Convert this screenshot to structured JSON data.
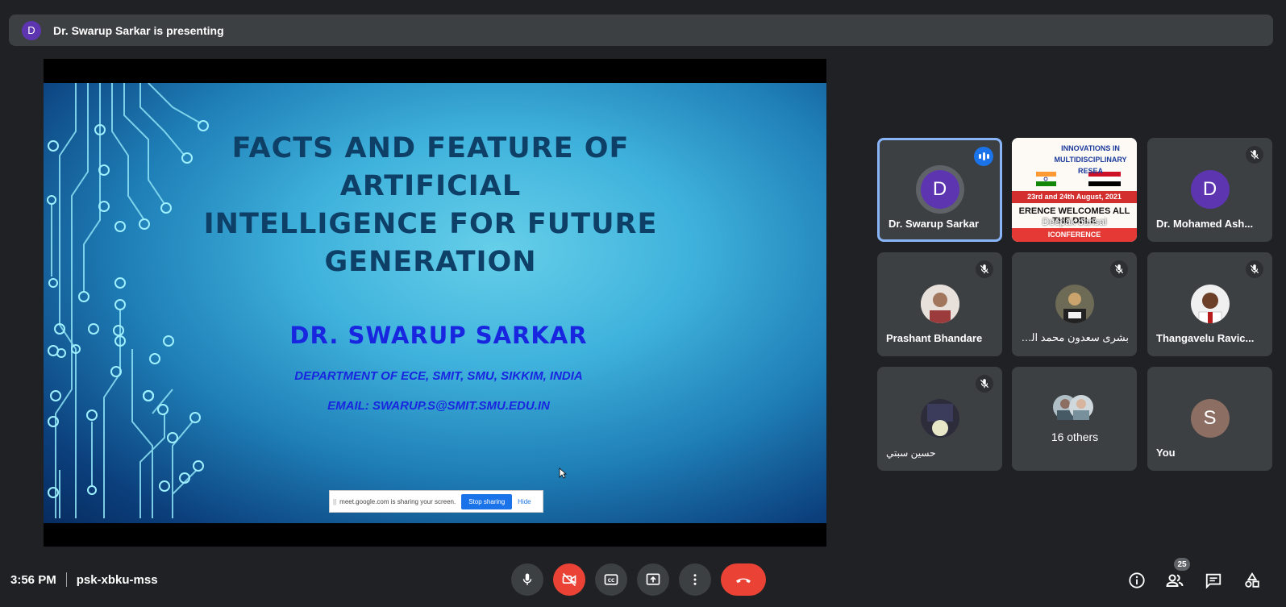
{
  "banner": {
    "avatar_letter": "D",
    "text": "Dr. Swarup Sarkar is presenting"
  },
  "slide": {
    "title_line1": "FACTS AND FEATURE OF ARTIFICIAL",
    "title_line2": "INTELLIGENCE FOR FUTURE",
    "title_line3": "GENERATION",
    "presenter": "DR. SWARUP SARKAR",
    "department": "DEPARTMENT OF ECE, SMIT, SMU, SIKKIM, INDIA",
    "email": "EMAIL: SWARUP.S@SMIT.SMU.EDU.IN"
  },
  "share_bar": {
    "message": "meet.google.com is sharing your screen.",
    "stop_label": "Stop sharing",
    "hide_label": "Hide"
  },
  "participants": [
    {
      "name": "Dr. Swarup Sarkar",
      "letter": "D",
      "color": "#5e35b1",
      "speaking": true
    },
    {
      "name": "Deepak bansal",
      "poster_title": "INNOVATIONS IN MULTIDISCIPLINARY RESEA",
      "poster_date": "23rd and 24th August, 2021",
      "poster_welcome": "ERENCE WELCOMES ALL THE DELE",
      "poster_org": "ICONFERENCE"
    },
    {
      "name": "Dr. Mohamed Ash...",
      "letter": "D",
      "color": "#5e35b1",
      "muted": true
    },
    {
      "name": "Prashant Bhandare",
      "muted": true
    },
    {
      "name": "بشرى سعدون محمد الدوري",
      "muted": true
    },
    {
      "name": "Thangavelu Ravic...",
      "muted": true
    },
    {
      "name": "حسين سبتي",
      "muted": true
    },
    {
      "name": "16 others"
    },
    {
      "name": "You",
      "letter": "S",
      "color": "#8d6e63"
    }
  ],
  "footer": {
    "time": "3:56 PM",
    "meeting_code": "psk-xbku-mss",
    "people_count": "25"
  }
}
